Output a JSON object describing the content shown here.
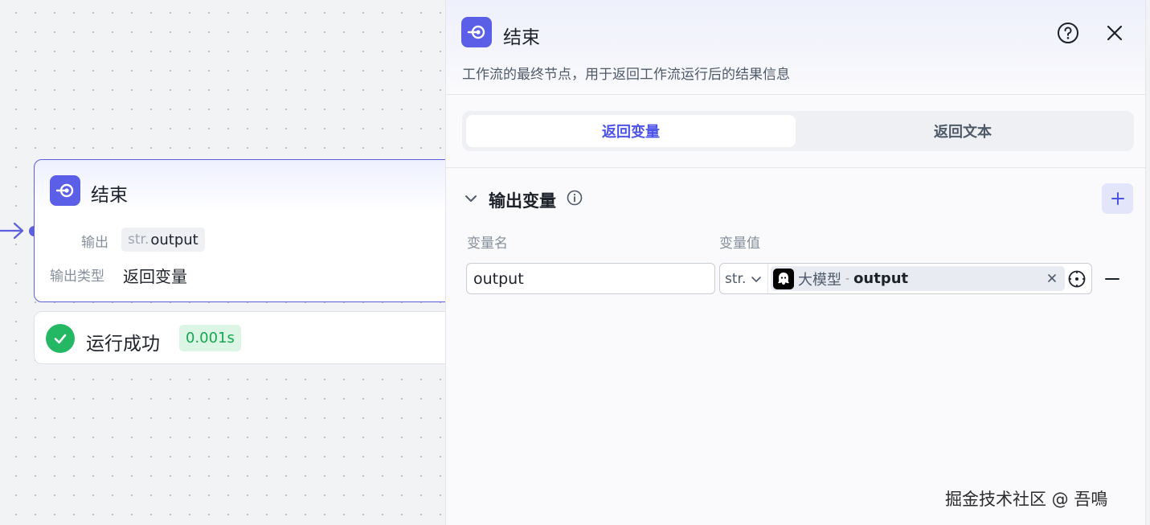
{
  "canvas": {
    "node": {
      "title": "结束",
      "output_label": "输出",
      "output_chip_type": "str.",
      "output_chip_name": "output",
      "output_type_label": "输出类型",
      "output_type_value": "返回变量"
    },
    "status": {
      "text": "运行成功",
      "duration": "0.001s",
      "color": "#25b864"
    }
  },
  "panel": {
    "title": "结束",
    "description": "工作流的最终节点，用于返回工作流运行后的结果信息",
    "tabs": [
      {
        "label": "返回变量",
        "active": true
      },
      {
        "label": "返回文本",
        "active": false
      }
    ],
    "section": {
      "title": "输出变量",
      "column_name": "变量名",
      "column_value": "变量值",
      "rows": [
        {
          "name": "output",
          "type": "str.",
          "ref_source": "大模型",
          "ref_separator": "-",
          "ref_variable": "output"
        }
      ]
    },
    "accent_color": "#4d53e8"
  },
  "icons": [
    "end-node-icon",
    "help-icon",
    "close-icon",
    "chevron-down-icon",
    "info-icon",
    "plus-icon",
    "llm-model-icon",
    "clear-icon",
    "variable-picker-icon",
    "minus-icon",
    "check-icon",
    "arrow-right-icon"
  ],
  "watermark": "掘金技术社区 @ 吾鳴"
}
